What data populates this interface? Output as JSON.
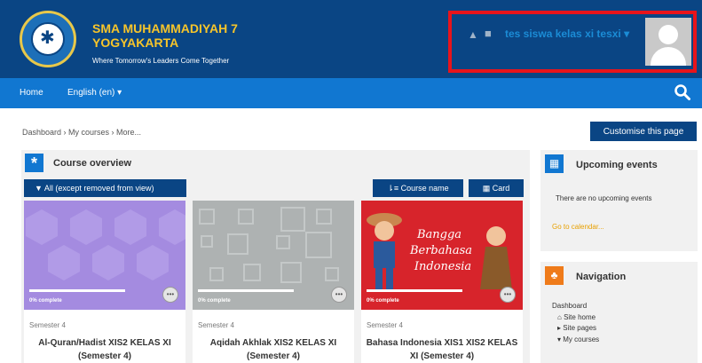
{
  "header": {
    "school_name": "SMA MUHAMMADIYAH 7 YOGYAKARTA",
    "tagline": "Where Tomorrow's Leaders Come Together",
    "user_name": "tes siswa kelas xi tesxi",
    "user_caret": "▾",
    "icons": [
      "bell-icon",
      "chat-icon"
    ]
  },
  "navbar": {
    "home": "Home",
    "language": "English (en) ▾"
  },
  "breadcrumb": "Dashboard › My courses › More...",
  "customise_button": "Customise this page",
  "course_overview": {
    "title": "Course overview",
    "filter": "▼ All (except removed from view)",
    "sort": "⇂≡ Course name",
    "view": "▦ Card",
    "courses": [
      {
        "category": "Semester 4",
        "title": "Al-Quran/Hadist XIS2 KELAS XI (Semester 4)",
        "progress_label": "0% complete",
        "progress": 0
      },
      {
        "category": "Semester 4",
        "title": "Aqidah Akhlak XIS2 KELAS XI (Semester 4)",
        "progress_label": "0% complete",
        "progress": 0
      },
      {
        "category": "Semester 4",
        "title": "Bahasa Indonesia XIS1 XIS2 KELAS XI (Semester 4)",
        "progress_label": "0% complete",
        "progress": 0,
        "image_text": "Bangga Berbahasa Indonesia"
      }
    ]
  },
  "upcoming_events": {
    "title": "Upcoming events",
    "empty_text": "There are no upcoming events",
    "calendar_link": "Go to calendar..."
  },
  "navigation": {
    "title": "Navigation",
    "dashboard": "Dashboard",
    "site_home": "Site home",
    "site_pages": "Site pages",
    "my_courses": "My courses"
  },
  "colors": {
    "header_bg": "#0a4584",
    "navbar_bg": "#1177d1",
    "school_name": "#f7c52a",
    "highlight_border": "#e8141b"
  }
}
